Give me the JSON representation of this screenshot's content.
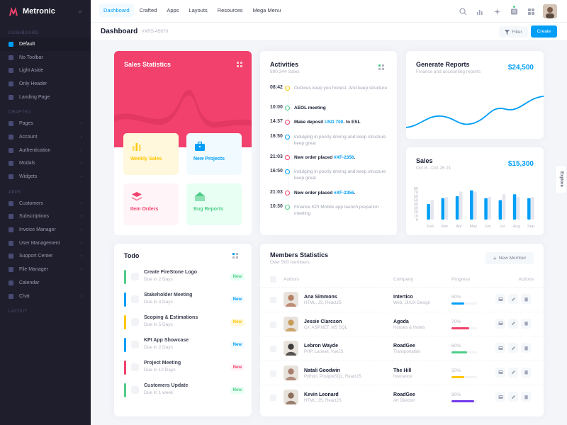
{
  "brand": {
    "name": "Metronic"
  },
  "sidebar": {
    "sections": [
      {
        "title": "DASHBOARD",
        "items": [
          {
            "label": "Default",
            "active": true,
            "chevron": false
          },
          {
            "label": "No Toolbar",
            "active": false,
            "chevron": false
          },
          {
            "label": "Light Aside",
            "active": false,
            "chevron": false
          },
          {
            "label": "Only Header",
            "active": false,
            "chevron": false
          },
          {
            "label": "Landing Page",
            "active": false,
            "chevron": false
          }
        ]
      },
      {
        "title": "CRAFTED",
        "items": [
          {
            "label": "Pages",
            "chevron": true
          },
          {
            "label": "Account",
            "chevron": true
          },
          {
            "label": "Authentication",
            "chevron": true
          },
          {
            "label": "Modals",
            "chevron": true
          },
          {
            "label": "Widgets",
            "chevron": true
          }
        ]
      },
      {
        "title": "APPS",
        "items": [
          {
            "label": "Customers",
            "chevron": true
          },
          {
            "label": "Subscriptions",
            "chevron": true
          },
          {
            "label": "Invoice Manager",
            "chevron": true
          },
          {
            "label": "User Management",
            "chevron": true
          },
          {
            "label": "Support Center",
            "chevron": true
          },
          {
            "label": "File Manager",
            "chevron": true
          },
          {
            "label": "Calendar",
            "chevron": false
          },
          {
            "label": "Chat",
            "chevron": true
          }
        ]
      },
      {
        "title": "LAYOUT",
        "items": []
      }
    ]
  },
  "header": {
    "nav": [
      "Dashboard",
      "Crafted",
      "Apps",
      "Layouts",
      "Resources",
      "Mega Menu"
    ],
    "icons": [
      "search-icon",
      "chart-icon",
      "sparkle-icon",
      "notes-icon",
      "grid-icon"
    ]
  },
  "toolbar": {
    "title": "Dashboard",
    "code": "#XRS-45670",
    "filter_label": "Filter",
    "create_label": "Create"
  },
  "sales_statistics": {
    "title": "Sales Statistics",
    "tiles": [
      {
        "label": "Weekly Sales",
        "color": "#ffc700",
        "bg": "#fff8dd",
        "icon": "bar-chart-icon"
      },
      {
        "label": "New Projects",
        "color": "#009ef7",
        "bg": "#f1faff",
        "icon": "briefcase-icon"
      },
      {
        "label": "Item Orders",
        "color": "#f1416c",
        "bg": "#fff5f8",
        "icon": "layers-icon"
      },
      {
        "label": "Bug Reports",
        "color": "#50cd89",
        "bg": "#e8fff3",
        "icon": "home-icon"
      }
    ]
  },
  "activities": {
    "title": "Activities",
    "subtitle": "890,344 Sales",
    "items": [
      {
        "time": "08:42",
        "color": "#ffc700",
        "text": "Outlines keep you honest. And keep structure",
        "bold": false
      },
      {
        "time": "10:00",
        "color": "#50cd89",
        "text": "AEOL meeting",
        "bold": true
      },
      {
        "time": "14:37",
        "color": "#f1416c",
        "text": "Make deposit ",
        "highlight": "USD 700",
        "after": ". to ESL",
        "bold": true
      },
      {
        "time": "16:50",
        "color": "#009ef7",
        "text": "Indulging in poorly driving and keep structure keep great",
        "bold": false
      },
      {
        "time": "21:03",
        "color": "#f1416c",
        "text": "New order placed ",
        "highlight": "#XF-2356",
        "after": ".",
        "bold": true
      },
      {
        "time": "16:50",
        "color": "#009ef7",
        "text": "Indulging in poorly driving and keep structure keep great",
        "bold": false
      },
      {
        "time": "21:03",
        "color": "#f1416c",
        "text": "New order placed ",
        "highlight": "#XF-2356",
        "after": ".",
        "bold": true
      },
      {
        "time": "10:30",
        "color": "#50cd89",
        "text": "Finance KPI Mobile app launch preparion meeting",
        "bold": false
      }
    ]
  },
  "reports": {
    "title": "Generate Reports",
    "subtitle": "Finance and accounting reports",
    "value": "$24,500"
  },
  "sales": {
    "title": "Sales",
    "subtitle": "Oct 8 - Oct 26 21",
    "value": "$15,300",
    "chart_data": {
      "type": "bar",
      "categories": [
        "Feb",
        "Mar",
        "Apr",
        "May",
        "Jun",
        "Jul",
        "Aug",
        "Sep"
      ],
      "series": [
        {
          "values": [
            40,
            55,
            60,
            75,
            55,
            50,
            65,
            55
          ],
          "color": "#009ef7"
        },
        {
          "values": [
            50,
            58,
            72,
            72,
            58,
            65,
            58,
            58
          ],
          "color": "#e4e6ef"
        }
      ],
      "yticks": [
        0,
        10,
        20,
        30,
        40,
        50,
        60,
        70,
        80
      ],
      "ylim": [
        0,
        80
      ]
    }
  },
  "todo": {
    "title": "Todo",
    "items": [
      {
        "name": "Create FireStone Logo",
        "due": "Due in 2 Days",
        "badge": "New",
        "color": "#50cd89",
        "badge_bg": "#e8fff3"
      },
      {
        "name": "Stakeholder Meeting",
        "due": "Due in 3 Days",
        "badge": "New",
        "color": "#009ef7",
        "badge_bg": "#f1faff"
      },
      {
        "name": "Scoping & Estimations",
        "due": "Due in 5 Days",
        "badge": "New",
        "color": "#ffc700",
        "badge_bg": "#fff8dd"
      },
      {
        "name": "KPI App Showcase",
        "due": "Due in 2 Days",
        "badge": "New",
        "color": "#009ef7",
        "badge_bg": "#f1faff"
      },
      {
        "name": "Project Meeting",
        "due": "Due in 12 Days",
        "badge": "New",
        "color": "#f1416c",
        "badge_bg": "#fff5f8"
      },
      {
        "name": "Customers Update",
        "due": "Due in 1 week",
        "badge": "New",
        "color": "#50cd89",
        "badge_bg": "#e8fff3"
      }
    ]
  },
  "members": {
    "title": "Members Statistics",
    "subtitle": "Over 500 members",
    "new_member_label": "New Member",
    "columns": [
      "Authors",
      "Company",
      "Progress",
      "Actions"
    ],
    "rows": [
      {
        "name": "Ana Simmons",
        "skills": "HTML, JS, ReactJS",
        "company": "Intertico",
        "company_sub": "Web, UI/UX Design",
        "progress_label": "50%",
        "progress": 0.5,
        "color": "#009ef7",
        "avatar": "#b57f64"
      },
      {
        "name": "Jessie Clarcson",
        "skills": "C#, ASP.NET, MS SQL",
        "company": "Agoda",
        "company_sub": "Houses & Hotels",
        "progress_label": "70%",
        "progress": 0.7,
        "color": "#f1416c",
        "avatar": "#c79b5a"
      },
      {
        "name": "Lebron Wayde",
        "skills": "PHP, Laravel, VueJS",
        "company": "RoadGee",
        "company_sub": "Transportation",
        "progress_label": "60%",
        "progress": 0.6,
        "color": "#50cd89",
        "avatar": "#3d3a3a"
      },
      {
        "name": "Natali Goodwin",
        "skills": "Python, PostgreSQL, ReactJS",
        "company": "The Hill",
        "company_sub": "Insurance",
        "progress_label": "50%",
        "progress": 0.5,
        "color": "#ffc700",
        "avatar": "#a87f6e"
      },
      {
        "name": "Kevin Leonard",
        "skills": "HTML, JS, ReactJS",
        "company": "RoadGee",
        "company_sub": "Art Director",
        "progress_label": "90%",
        "progress": 0.9,
        "color": "#7239ea",
        "avatar": "#8b6f5c"
      }
    ]
  },
  "explore": {
    "label": "Explore"
  }
}
